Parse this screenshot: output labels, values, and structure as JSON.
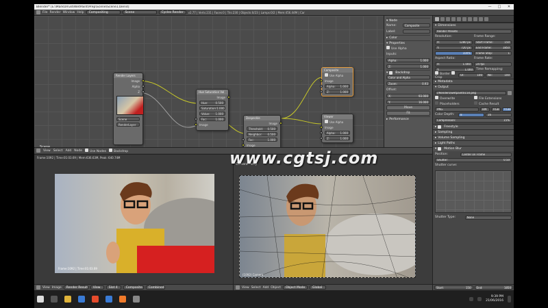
{
  "window": {
    "title": "Blender* [E:\\MarkOm3d\\WetPaint\\Prep\\Scene\\Scene1.blend]"
  },
  "infobar": {
    "menus": [
      "File",
      "Render",
      "Window",
      "Help"
    ],
    "screen": "Compositing",
    "scene": "Scene",
    "engine": "Cycles Render",
    "stats": "v2.77 | Verts:231 | Faces:0 | Tris:230 | Objects:0/23 | Lamps:0/2 | Mem:456.44M | Car"
  },
  "node_editor": {
    "label": "Scene",
    "nodes": {
      "render_layers": {
        "title": "Render Layers",
        "out_image": "Image",
        "out_alpha": "Alpha",
        "out_z": "Z",
        "scene": "Scene",
        "layer": "RenderLayer"
      },
      "hsv": {
        "title": "Hue Saturation Val",
        "out": "Image",
        "hue_label": "Hue:",
        "hue": "0.500",
        "sat_label": "Saturation:",
        "sat": "1.000",
        "val_label": "Value:",
        "val": "1.000",
        "fac_label": "Fac:",
        "fac": "1.000",
        "in": "Image"
      },
      "composite": {
        "title": "Composite",
        "use_alpha": "Use Alpha",
        "in_image": "Image",
        "alpha_label": "Alpha:",
        "alpha": "1.000",
        "z_label": "Z:",
        "z": "1.000"
      },
      "despeckle": {
        "title": "Despeckle",
        "out": "Image",
        "thr_label": "Threshold:",
        "thr": "0.500",
        "nei_label": "Neighbor:",
        "nei": "0.500",
        "fac_label": "Fac:",
        "fac": "1.000",
        "in": "Image"
      },
      "viewer": {
        "title": "Viewer",
        "use_alpha": "Use Alpha",
        "in_image": "Image",
        "alpha_label": "Alpha:",
        "alpha": "1.000",
        "z_label": "Z:",
        "z": "1.000"
      }
    }
  },
  "node_panel": {
    "section": "Node",
    "name_label": "Name:",
    "name": "Composite",
    "label_label": "Label:",
    "color": "Color",
    "properties": "Properties",
    "use_alpha": "Use Alpha",
    "inputs": "Inputs:",
    "alpha_label": "Alpha:",
    "alpha": "1.000",
    "z_label": "Z:",
    "z": "1.000",
    "backdrop": "Backdrop",
    "channels": "Color and Alpha",
    "zoom_label": "Zoom:",
    "zoom": "0.93",
    "offset": "Offset:",
    "ox_label": "X:",
    "ox": "93.000",
    "oy_label": "Y:",
    "oy": "16.000",
    "move": "Move",
    "fit": "Fit",
    "performance": "Performance"
  },
  "props": {
    "dimensions": "Dimensions",
    "preset": "Render Presets",
    "resolution": "Resolution:",
    "res_x_label": "X:",
    "res_x": "1280 px",
    "res_y_label": "Y:",
    "res_y": "720 px",
    "res_pct": "100%",
    "frame_range": "Frame Range:",
    "start_label": "Start Frame:",
    "start": "150",
    "end_label": "End Frame:",
    "end": "1850",
    "step_label": "Frame Step:",
    "step": "1",
    "aspect": "Aspect Ratio:",
    "asp_x_label": "X:",
    "asp_x": "1.000",
    "asp_y_label": "Y:",
    "asp_y": "1.000",
    "frame_rate": "Frame Rate:",
    "fps": "24 fps",
    "time_remap": "Time Remapping:",
    "old_label": "Ol:",
    "old": "100",
    "new_label": "Ne:",
    "new": "100",
    "border": "Border",
    "crop": "Crop",
    "metadata": "Metadata",
    "output": "Output",
    "out_path": "//Renders/wetpaint0150.png",
    "overwrite": "Overwrite",
    "file_ext": "File Extensions",
    "placeholders": "Placeholders",
    "cache": "Cache Result",
    "format": "PNG",
    "bw": "BW",
    "rgb": "RGB",
    "rgba": "RGBA",
    "depth_label": "Color Depth:",
    "depth8": "8",
    "depth16": "16",
    "compression_label": "Compression:",
    "compression": "15%",
    "freestyle": "Freestyle",
    "sampling": "Sampling",
    "volume": "Volume Sampling",
    "light_paths": "Light Paths",
    "motion_blur": "Motion Blur",
    "position_label": "Position:",
    "position": "Center on Frame",
    "shutter_label": "Shutter:",
    "shutter": "0.50",
    "shutter_curve": "Shutter curve:",
    "shutter_type_label": "Shutter Type:",
    "shutter_type": "None",
    "start_f_label": "Start:",
    "start_f": "150",
    "end_f_label": "End:",
    "end_f": "1850"
  },
  "image_editor": {
    "status": "Frame:1092 | Time:01:03.69 | Mem:636.63M, Peak: 640.74M",
    "menus": [
      "View",
      "Image"
    ],
    "image": "Render Result",
    "view_label": "View",
    "slot": "Slot 4",
    "layer": "Composite",
    "pass": "Combined",
    "corner": "Frame:1092 | Time:01:03.69"
  },
  "viewport": {
    "label": "Camera Persp",
    "menus": [
      "View",
      "Select",
      "Add",
      "Object"
    ],
    "mode": "Object Mode",
    "orientation": "Global",
    "frame_label": "(1092) Camera"
  },
  "node_footer": {
    "menus": [
      "View",
      "Select",
      "Add",
      "Node"
    ],
    "use_nodes": "Use Nodes",
    "backdrop": "Backdrop"
  },
  "watermark": "www.cgtsj.com",
  "taskbar": {
    "time": "9:39 PM",
    "date": "21/06/2016"
  }
}
